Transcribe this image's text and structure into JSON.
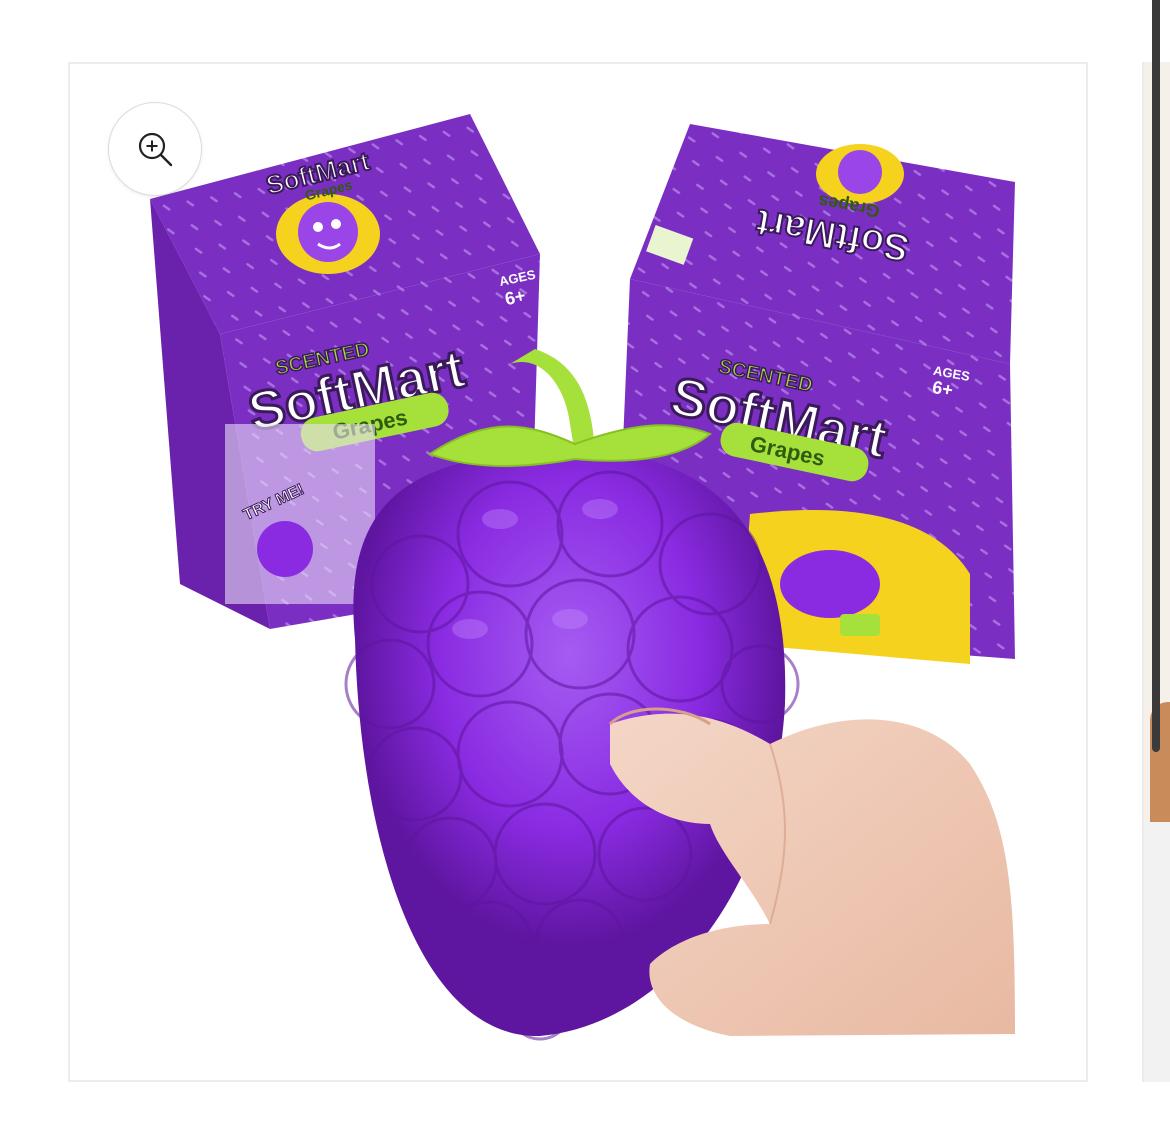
{
  "gallery": {
    "zoom_icon": "zoom-in-icon",
    "image_alt": "Scented SoftMart Grapes squishy toy",
    "product": {
      "box_left": {
        "small_logo_top": "SCENTED",
        "small_logo_main": "SoftMart",
        "small_logo_sub": "Grapes",
        "ages_label": "AGES",
        "ages_value": "6+",
        "logo_top": "SCENTED",
        "logo_main": "SoftMart",
        "logo_sub": "Grapes",
        "try_me": "TRY ME!"
      },
      "box_right": {
        "logo_top": "SCENTED",
        "logo_main": "SoftMart",
        "logo_sub": "Grapes",
        "ages_label": "AGES",
        "ages_value": "6+"
      }
    }
  },
  "colors": {
    "box_purple": "#7b2fc2",
    "grape_purple": "#8a2be2",
    "stem_green": "#a6e03a",
    "logo_yellow": "#f5d21e"
  }
}
